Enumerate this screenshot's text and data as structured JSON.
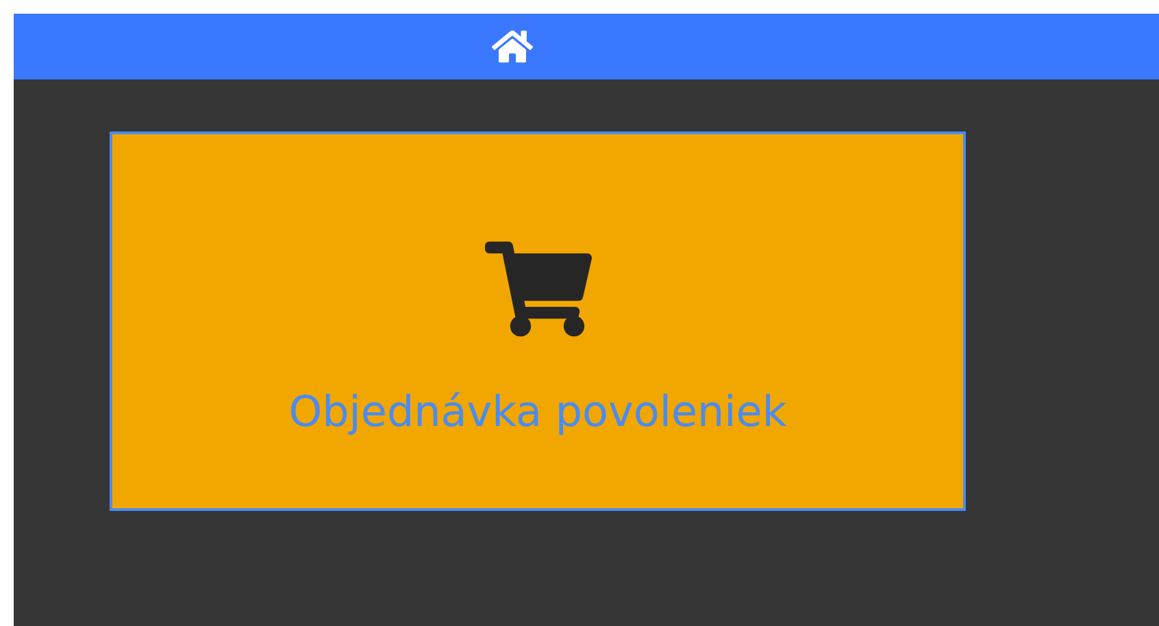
{
  "tiles": [
    {
      "label": "Objednávka povoleniek"
    }
  ]
}
